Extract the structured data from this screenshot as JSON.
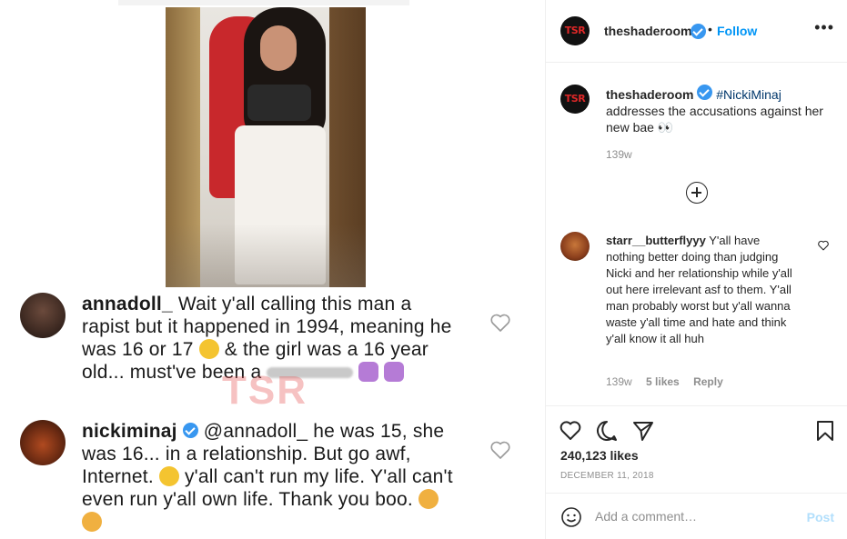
{
  "media": {
    "comments": [
      {
        "username": "annadoll_",
        "text_before": "Wait y'all calling this man a rapist but it happened in 1994, meaning he was 16 or 17",
        "text_after": "& the girl was a 16 year old... must've been a",
        "text_tail": "white girl"
      },
      {
        "username": "nickiminaj",
        "text_before": "@annadoll_ he was 15, she was 16... in a relationship. But go awf, Internet.",
        "text_mid": "y'all can't run my life. Y'all can't even run y'all own life. Thank you boo."
      }
    ],
    "watermark": "TSR"
  },
  "header": {
    "avatar_text": "TSR",
    "username": "theshaderoom",
    "dot": "•",
    "follow_label": "Follow",
    "more_label": "•••"
  },
  "caption": {
    "avatar_text": "TSR",
    "username": "theshaderoom",
    "hashtag": "#NickiMinaj",
    "text": "addresses the accusations against her new bae 👀",
    "time": "139w"
  },
  "reply": {
    "username": "starr__butterflyyy",
    "text": "Y'all have nothing better doing than judging Nicki and her relationship while y'all out here irrelevant asf to them. Y'all man probably worst but y'all wanna waste y'all time and hate and think y'all know it all huh",
    "time": "139w",
    "likes": "5 likes",
    "reply_label": "Reply"
  },
  "actions": {
    "likes": "240,123 likes",
    "date": "DECEMBER 11, 2018"
  },
  "add_comment": {
    "placeholder": "Add a comment…",
    "post_label": "Post"
  },
  "colors": {
    "link_blue": "#0095f6",
    "post_disabled": "#b2dffc",
    "verified": "#3897f0",
    "muted": "#8e8e8e"
  }
}
